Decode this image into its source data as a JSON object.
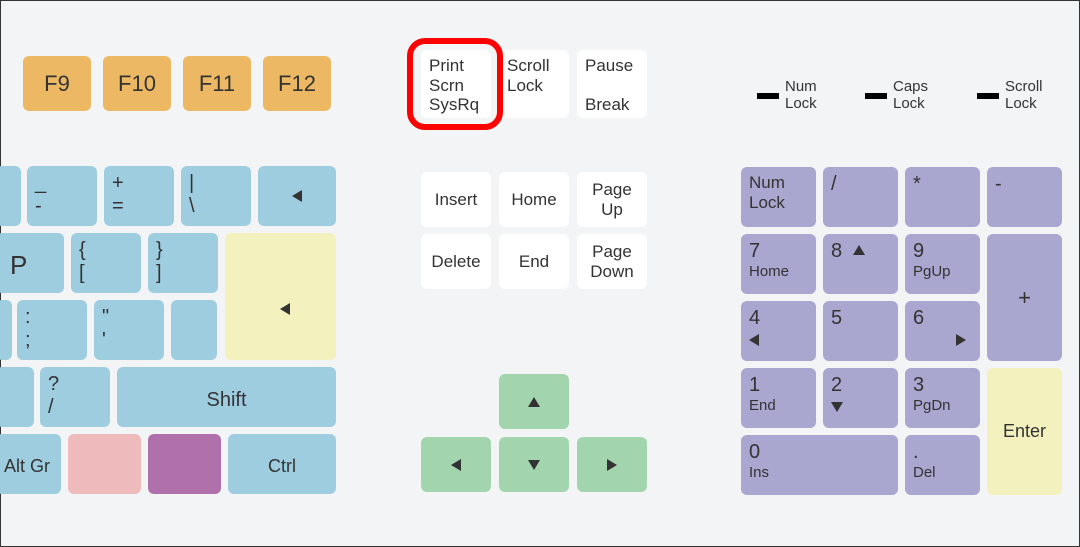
{
  "fkeys": {
    "f9": "F9",
    "f10": "F10",
    "f11": "F11",
    "f12": "F12"
  },
  "sys": {
    "prtsc": "Print\nScrn\nSysRq",
    "scrlk": "Scroll\nLock",
    "pause": "Pause\n\nBreak"
  },
  "nav": {
    "insert": "Insert",
    "home": "Home",
    "pgup": "Page\nUp",
    "delete": "Delete",
    "end": "End",
    "pgdn": "Page\nDown"
  },
  "leds": {
    "num": "Num\nLock",
    "caps": "Caps\nLock",
    "scroll": "Scroll\nLock"
  },
  "main": {
    "minus_top": "_",
    "minus_bot": "-",
    "plus_top": "+",
    "plus_bot": "=",
    "pipe_top": "|",
    "pipe_bot": "\\",
    "p": "P",
    "lbrace_top": "{",
    "lbrace_bot": "[",
    "rbrace_top": "}",
    "rbrace_bot": "]",
    "colon_top": ":",
    "colon_bot": ";",
    "quote_top": "\"",
    "quote_bot": "'",
    "question_top": "?",
    "question_bot": "/",
    "shift": "Shift",
    "altgr": "Alt Gr",
    "ctrl": "Ctrl"
  },
  "numpad": {
    "numlock": "Num\nLock",
    "slash": "/",
    "star": "*",
    "minus": "-",
    "plus": "+",
    "k7": "7",
    "k7s": "Home",
    "k8": "8",
    "k9": "9",
    "k9s": "PgUp",
    "k4": "4",
    "k5": "5",
    "k6": "6",
    "k1": "1",
    "k1s": "End",
    "k2": "2",
    "k3": "3",
    "k3s": "PgDn",
    "k0": "0",
    "k0s": "Ins",
    "dot": ".",
    "dots": "Del",
    "enter": "Enter"
  },
  "colors": {
    "blue": "#9ecde0",
    "orange": "#edb863",
    "yellow": "#f3f1bd",
    "purple": "#a9a6cf",
    "green": "#a2d5ad",
    "pink": "#eebabc",
    "violet": "#b070ab",
    "white": "#ffffff",
    "highlight": "#fe0000"
  }
}
